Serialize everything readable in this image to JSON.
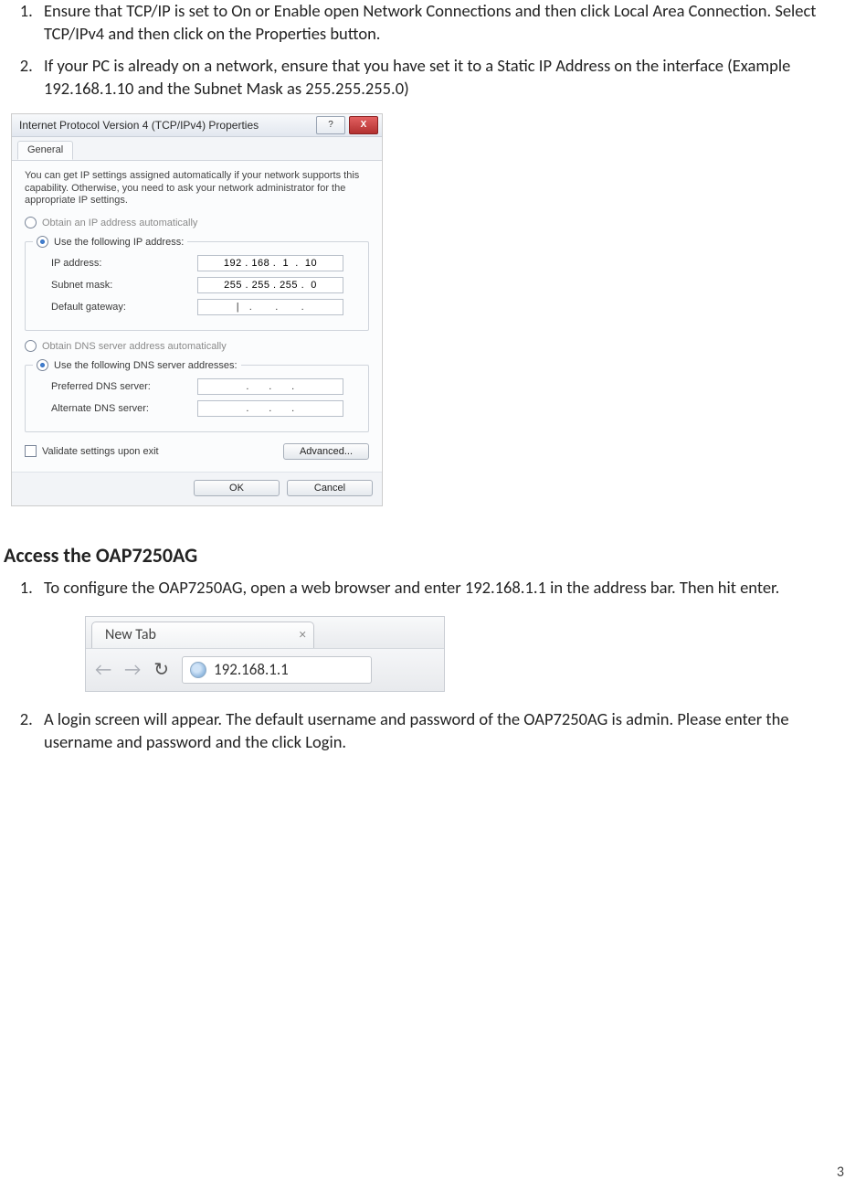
{
  "page_number": "3",
  "steps_top": [
    "Ensure that TCP/IP is set to On or Enable open Network Connections and then click Local Area Connection. Select TCP/IPv4 and then click on the Properties button.",
    "If your PC is already on a network, ensure that you have set it to a Static IP Address on the interface (Example 192.168.1.10 and the Subnet Mask as 255.255.255.0)"
  ],
  "ipv4": {
    "title": "Internet Protocol Version 4 (TCP/IPv4) Properties",
    "help_glyph": "?",
    "close_glyph": "X",
    "tab": "General",
    "description": "You can get IP settings assigned automatically if your network supports this capability. Otherwise, you need to ask your network administrator for the appropriate IP settings.",
    "radio_obtain_ip": "Obtain an IP address automatically",
    "radio_use_ip": "Use the following IP address:",
    "labels": {
      "ip": "IP address:",
      "subnet": "Subnet mask:",
      "gateway": "Default gateway:",
      "pref_dns": "Preferred DNS server:",
      "alt_dns": "Alternate DNS server:"
    },
    "values": {
      "ip": "192 . 168 .  1  .  10",
      "subnet": "255 . 255 . 255 .  0",
      "gateway": "|   .       .       .",
      "pref_dns": ".      .      .",
      "alt_dns": ".      .      ."
    },
    "radio_obtain_dns": "Obtain DNS server address automatically",
    "radio_use_dns": "Use the following DNS server addresses:",
    "validate": "Validate settings upon exit",
    "advanced": "Advanced...",
    "ok": "OK",
    "cancel": "Cancel"
  },
  "section_access": "Access the OAP7250AG",
  "steps_access": [
    "To configure the OAP7250AG, open a web browser and enter 192.168.1.1 in the address bar. Then hit enter.",
    "A login screen will appear. The default username and password of the OAP7250AG is admin. Please enter the username and password and the click Login."
  ],
  "browser": {
    "tab_label": "New Tab",
    "close_glyph": "×",
    "back_glyph": "←",
    "forward_glyph": "→",
    "reload_glyph": "↻",
    "address": "192.168.1.1"
  }
}
